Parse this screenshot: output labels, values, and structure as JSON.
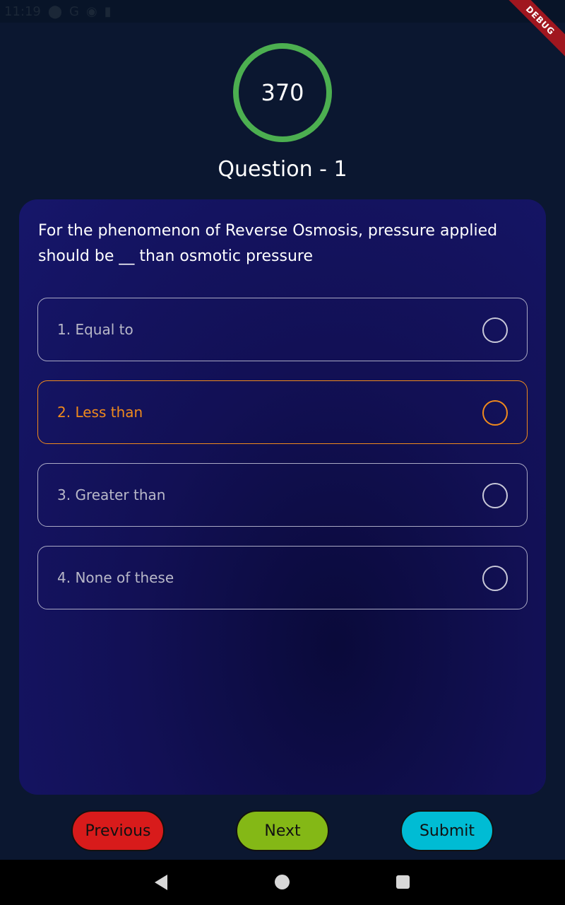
{
  "status_bar": {
    "time": "11:19",
    "icons": [
      "location-icon",
      "google-icon",
      "google-play-icon",
      "sd-card-icon"
    ]
  },
  "debug_banner": "DEBUG",
  "timer": {
    "value": "370",
    "ring_color": "#4caf50"
  },
  "question": {
    "title": "Question - 1",
    "text": "For the phenomenon of Reverse Osmosis, pressure applied should be __ than osmotic pressure"
  },
  "options": [
    {
      "label": "1. Equal to",
      "selected": false
    },
    {
      "label": "2. Less than",
      "selected": true
    },
    {
      "label": "3. Greater than",
      "selected": false
    },
    {
      "label": "4. None of these",
      "selected": false
    }
  ],
  "buttons": {
    "previous": {
      "label": "Previous",
      "color": "#d81b1b"
    },
    "next": {
      "label": "Next",
      "color": "#84b816"
    },
    "submit": {
      "label": "Submit",
      "color": "#00bcd4"
    }
  },
  "colors": {
    "background": "#0b1730",
    "selected_accent": "#f08a1c"
  },
  "nav": [
    "back-icon",
    "home-icon",
    "recent-apps-icon"
  ]
}
